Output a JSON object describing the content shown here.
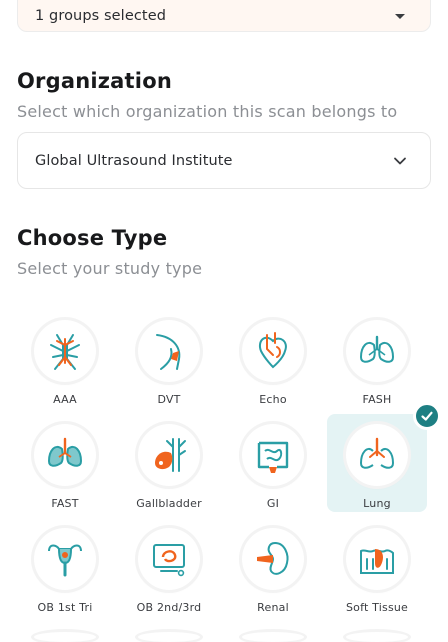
{
  "groups": {
    "value": "1 groups selected"
  },
  "organization": {
    "title": "Organization",
    "subtitle": "Select which organization this scan belongs to",
    "value": "Global Ultrasound Institute"
  },
  "type": {
    "title": "Choose Type",
    "subtitle": "Select your study type",
    "selected": "Lung",
    "items": [
      {
        "label": "AAA",
        "icon": "aaa-icon"
      },
      {
        "label": "DVT",
        "icon": "dvt-icon"
      },
      {
        "label": "Echo",
        "icon": "echo-icon"
      },
      {
        "label": "FASH",
        "icon": "fash-icon"
      },
      {
        "label": "FAST",
        "icon": "fast-icon"
      },
      {
        "label": "Gallbladder",
        "icon": "gallbladder-icon"
      },
      {
        "label": "GI",
        "icon": "gi-icon"
      },
      {
        "label": "Lung",
        "icon": "lung-icon"
      },
      {
        "label": "OB 1st Tri",
        "icon": "ob-1st-tri-icon"
      },
      {
        "label": "OB 2nd/3rd",
        "icon": "ob-2nd-3rd-icon"
      },
      {
        "label": "Renal",
        "icon": "renal-icon"
      },
      {
        "label": "Soft Tissue",
        "icon": "soft-tissue-icon"
      }
    ]
  },
  "colors": {
    "teal": "#2a9ea5",
    "orange": "#f0641e",
    "selected_bg": "#e4f3f4",
    "check": "#1e7f83"
  }
}
